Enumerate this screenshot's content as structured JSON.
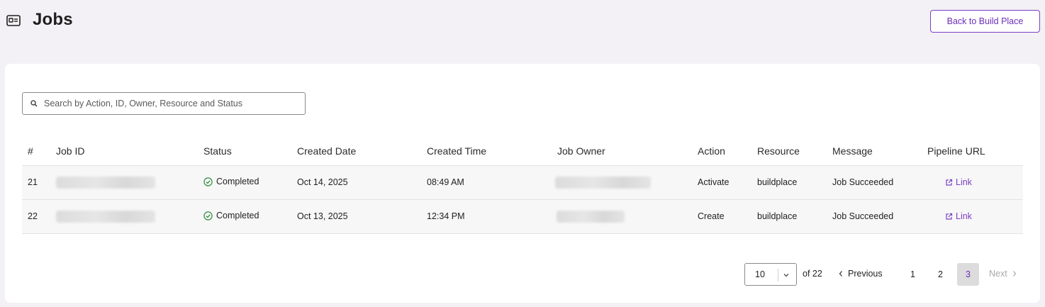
{
  "header": {
    "title": "Jobs",
    "icon": "jobs-card-icon",
    "back_button_label": "Back to Build Place"
  },
  "search": {
    "placeholder": "Search by Action, ID, Owner, Resource and Status",
    "value": ""
  },
  "table": {
    "columns": [
      "#",
      "Job ID",
      "Status",
      "Created Date",
      "Created Time",
      "Job Owner",
      "Action",
      "Resource",
      "Message",
      "Pipeline URL"
    ],
    "rows": [
      {
        "num": "21",
        "job_id": "",
        "status": "Completed",
        "created_date": "Oct 14, 2025",
        "created_time": "08:49 AM",
        "job_owner": "",
        "action": "Activate",
        "resource": "buildplace",
        "message": "Job Succeeded",
        "pipeline_link": "Link"
      },
      {
        "num": "22",
        "job_id": "",
        "status": "Completed",
        "created_date": "Oct 13, 2025",
        "created_time": "12:34 PM",
        "job_owner": "",
        "action": "Create",
        "resource": "buildplace",
        "message": "Job Succeeded",
        "pipeline_link": "Link"
      }
    ]
  },
  "pagination": {
    "page_size": "10",
    "of_total": "of 22",
    "previous_label": "Previous",
    "next_label": "Next",
    "pages": [
      "1",
      "2",
      "3"
    ],
    "current_page": "3"
  },
  "colors": {
    "accent": "#7b3fc4",
    "success": "#2e8b3e",
    "background": "#f3f1f5"
  }
}
